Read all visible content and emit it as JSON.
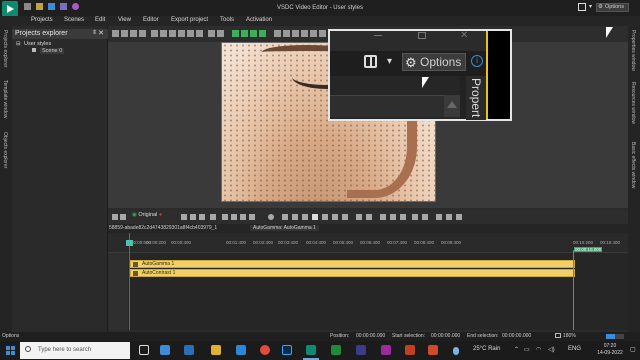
{
  "app": {
    "title": "VSDC Video Editor - User styles"
  },
  "menu": [
    "Projects",
    "Scenes",
    "Edit",
    "View",
    "Editor",
    "Export project",
    "Tools",
    "Activation"
  ],
  "title_right": {
    "options_label": "Options"
  },
  "left_tabs": [
    "Projects explorer",
    "Template window",
    "Objects explorer"
  ],
  "right_tabs": [
    "Properties window",
    "Resources window",
    "Basic effects window"
  ],
  "explorer": {
    "title": "Projects explorer",
    "close": "✕",
    "tree": [
      "User styles",
      "Scene 0"
    ]
  },
  "zoom_popup": {
    "options_label": "Options",
    "info": "i",
    "properties_label": "Propert"
  },
  "timeline": {
    "original_label": "Original",
    "tabs": [
      "58859-abade82c2d4743829301a8f4cb403979_1",
      "AutoGamma: AutoGamma 1"
    ],
    "ruler_labels": [
      "00:00:000",
      "00:00:200",
      "00:00:400",
      "00:01:400",
      "00:02:400",
      "00:03:400",
      "00:04:400",
      "00:05:400",
      "00:06:400",
      "00:07:400",
      "00:08:400",
      "00:09:400",
      "00:10:200",
      "00:10:400"
    ],
    "ruler_end_label": "00:00:10.000",
    "clips": [
      {
        "name": "AutoGamma 1"
      },
      {
        "name": "AutoContrast 1"
      }
    ]
  },
  "status": {
    "left": "Options",
    "position_label": "Position:",
    "position_value": "00:00:00.000",
    "start_label": "Start selection:",
    "start_value": "00:00:00.000",
    "end_label": "End selection:",
    "end_value": "00:00:00.000",
    "zoom": "180%",
    "progress": 0.5
  },
  "taskbar": {
    "search_placeholder": "Type here to search",
    "weather": "25°C  Rain",
    "language": "ENG",
    "time": "07:20",
    "date": "14-09-2022"
  },
  "colors": {
    "accent": "#3d8bd9",
    "clip": "#f1d06a",
    "playhead": "#d23a3a",
    "logo": "#0e8a6e"
  }
}
